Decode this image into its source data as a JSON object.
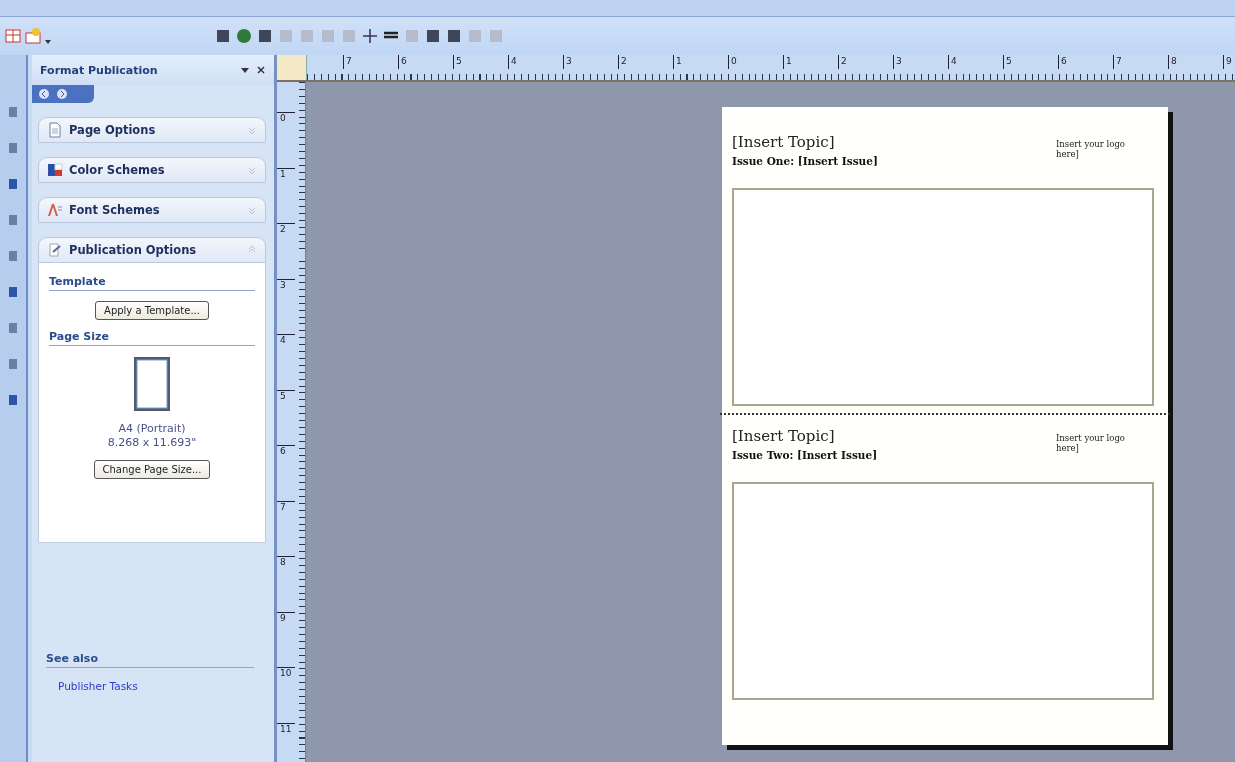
{
  "task_pane": {
    "title": "Format Publication",
    "sections": [
      {
        "label": "Page Options",
        "kind": "page",
        "expanded": false
      },
      {
        "label": "Color Schemes",
        "kind": "color",
        "expanded": false
      },
      {
        "label": "Font Schemes",
        "kind": "font",
        "expanded": false
      },
      {
        "label": "Publication Options",
        "kind": "publication",
        "expanded": true
      }
    ],
    "template_heading": "Template",
    "apply_button": "Apply a Template...",
    "page_size_heading": "Page Size",
    "page_size_name": "A4 (Portrait)",
    "page_size_dims": "8.268 x 11.693\"",
    "change_button": "Change Page Size...",
    "see_also_heading": "See also",
    "see_also_links": [
      "Publisher Tasks"
    ]
  },
  "rulers": {
    "horizontal": [
      "7",
      "6",
      "5",
      "4",
      "3",
      "2",
      "1",
      "0",
      "1",
      "2",
      "3",
      "4",
      "5",
      "6",
      "7",
      "8",
      "9"
    ],
    "vertical": [
      "0",
      "1",
      "2",
      "3",
      "4",
      "5",
      "6",
      "7",
      "8",
      "9",
      "10",
      "11"
    ]
  },
  "publication": {
    "sections": [
      {
        "topic": "[Insert Topic]",
        "issue": "Issue One: [Insert Issue]",
        "logo": "Insert your logo here]"
      },
      {
        "topic": "[Insert Topic]",
        "issue": "Issue Two: [Insert Issue]",
        "logo": "Insert your logo here]"
      }
    ]
  }
}
